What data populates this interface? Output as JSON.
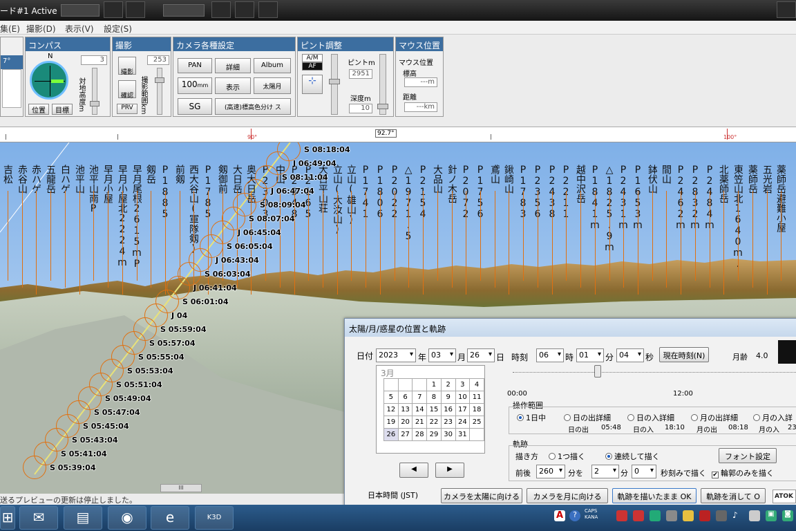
{
  "window": {
    "title": "ード#1 Active",
    "tab1": "",
    "tab2": ""
  },
  "menu": {
    "items": [
      "集(E)",
      "撮影(D)",
      "表示(V)",
      "設定(S)"
    ]
  },
  "panels": {
    "left_value": "7°",
    "compass": {
      "title": "コンパス",
      "north": "N",
      "btn_position": "位置",
      "btn_target": "目標",
      "alt_label": "対地高度m",
      "alt_value": "3"
    },
    "shoot": {
      "title": "撮影",
      "btn_shoot": "撮影",
      "btn_confirm": "確認",
      "btn_prv": "PRV",
      "range_label": "撮影範囲km",
      "range_value": "253"
    },
    "camera": {
      "title": "カメラ各種設定",
      "btn_pan": "PAN",
      "btn_detail": "詳細",
      "btn_album": "Album",
      "btn_100": "100",
      "btn_100_unit": "mm",
      "btn_display": "表示",
      "btn_sunmoon": "太陽月",
      "btn_sg": "SG",
      "btn_hq": "(高速)標高色分け ス"
    },
    "focus": {
      "title": "ピント調整",
      "btn_am": "A/M",
      "btn_af": "AF",
      "focus_label": "ピントm",
      "focus_value": "2951",
      "depth_label": "深度m",
      "depth_value": "10"
    },
    "mouse": {
      "title": "マウス位置",
      "pos_label": "マウス位置",
      "alt_label": "標高",
      "alt_value": "---m",
      "dist_label": "距離",
      "dist_value": "---km"
    }
  },
  "ruler": {
    "mark1": "90°",
    "mark2": "92.7°",
    "mark3": "100°"
  },
  "peaks": [
    "吉松",
    "赤谷山",
    "赤ハゲ",
    "五龍岳",
    "白ハゲ",
    "池平山",
    "池平山南P",
    "早月小屋",
    "早月小屋北2224mP",
    "早月尾根2615mP",
    "剱岳",
    "P1885",
    "前剱",
    "西大谷山(軍隊剱)",
    "P1785",
    "剱御前",
    "大日岳",
    "奥大日岳",
    "P2303",
    "中山",
    "P2348",
    "P2165",
    "大日平山荘",
    "立山(大汝山)",
    "立山(雄山)",
    "P1741",
    "P1806",
    "P2022",
    "△1971.5",
    "P2154",
    "大品山",
    "針ノ木岳",
    "P2072",
    "P1756",
    "鳶山",
    "鍬崎山",
    "P1783",
    "P2356",
    "P2438",
    "P2211",
    "越中沢岳",
    "P1841m",
    "△1825.9m",
    "P2431m",
    "P1653m",
    "鉢伏山",
    "間山",
    "P2462m",
    "P2832m",
    "P2484m",
    "北薬師岳",
    "東笠山北1640m.P",
    "薬師岳",
    "五光岩",
    "薬師岳避難小屋"
  ],
  "sun_times": [
    "S 08:18:04",
    "J 06:49:04",
    "S 08:11:04",
    "J 06:47:04",
    "S 08:09:04",
    "S 08:07:04",
    "J 06:45:04",
    "S 06:05:04",
    "J 06:43:04",
    "S 06:03:04",
    "J 06:41:04",
    "S 06:01:04",
    "J 04",
    "S 05:59:04",
    "S 05:57:04",
    "S 05:55:04",
    "S 05:53:04",
    "S 05:51:04",
    "S 05:49:04",
    "S 05:47:04",
    "S 05:45:04",
    "S 05:43:04",
    "S 05:41:04",
    "S 05:39:04"
  ],
  "status": {
    "text": "送るプレビューの更新は停止しました。",
    "scroll": "III"
  },
  "dialog": {
    "title": "太陽/月/惑星の位置と軌跡",
    "date_label": "日付",
    "year": "2023",
    "year_unit": "年",
    "month": "03",
    "month_unit": "月",
    "day": "26",
    "day_unit": "日",
    "time_label": "時刻",
    "hour": "06",
    "hour_unit": "時",
    "minute": "01",
    "minute_unit": "分",
    "second": "04",
    "second_unit": "秒",
    "now_btn": "現在時刻(N)",
    "moon_age_label": "月齢",
    "moon_age": "4.0",
    "cal_title": "3月",
    "cal_rows": [
      [
        "",
        "",
        "",
        "1",
        "2",
        "3",
        "4"
      ],
      [
        "5",
        "6",
        "7",
        "8",
        "9",
        "10",
        "11"
      ],
      [
        "12",
        "13",
        "14",
        "15",
        "16",
        "17",
        "18"
      ],
      [
        "19",
        "20",
        "21",
        "22",
        "23",
        "24",
        "25"
      ],
      [
        "26",
        "27",
        "28",
        "29",
        "30",
        "31",
        ""
      ]
    ],
    "slider_start": "00:00",
    "slider_mid": "12:00",
    "op_range_label": "操作範囲",
    "op_options": [
      "1日中",
      "日の出詳細",
      "日の入詳細",
      "月の出詳細",
      "月の入詳"
    ],
    "sunrise_label": "日の出",
    "sunrise": "05:48",
    "sunset_label": "日の入",
    "sunset": "18:10",
    "moonrise_label": "月の出",
    "moonrise": "08:18",
    "moonset_label": "月の入",
    "moonset": "23",
    "trail_label": "軌跡",
    "draw_label": "描き方",
    "draw_once": "1つ描く",
    "draw_cont": "連続して描く",
    "font_btn": "フォント設定",
    "range_label": "前後",
    "range_value": "260",
    "range_unit": "分を",
    "step_value": "2",
    "step_unit": "分",
    "offset_value": "0",
    "offset_unit": "秒刻みで描く",
    "outline_only": "輪郭のみを描く",
    "tz_label": "日本時間 (JST)",
    "btn_cam_sun": "カメラを太陽に向ける",
    "btn_cam_moon": "カメラを月に向ける",
    "btn_draw_ok": "軌跡を描いたまま OK",
    "btn_erase": "軌跡を消して O",
    "atok": "ATOK"
  },
  "tray": {
    "caps": "CAPS",
    "kana": "KANA"
  }
}
